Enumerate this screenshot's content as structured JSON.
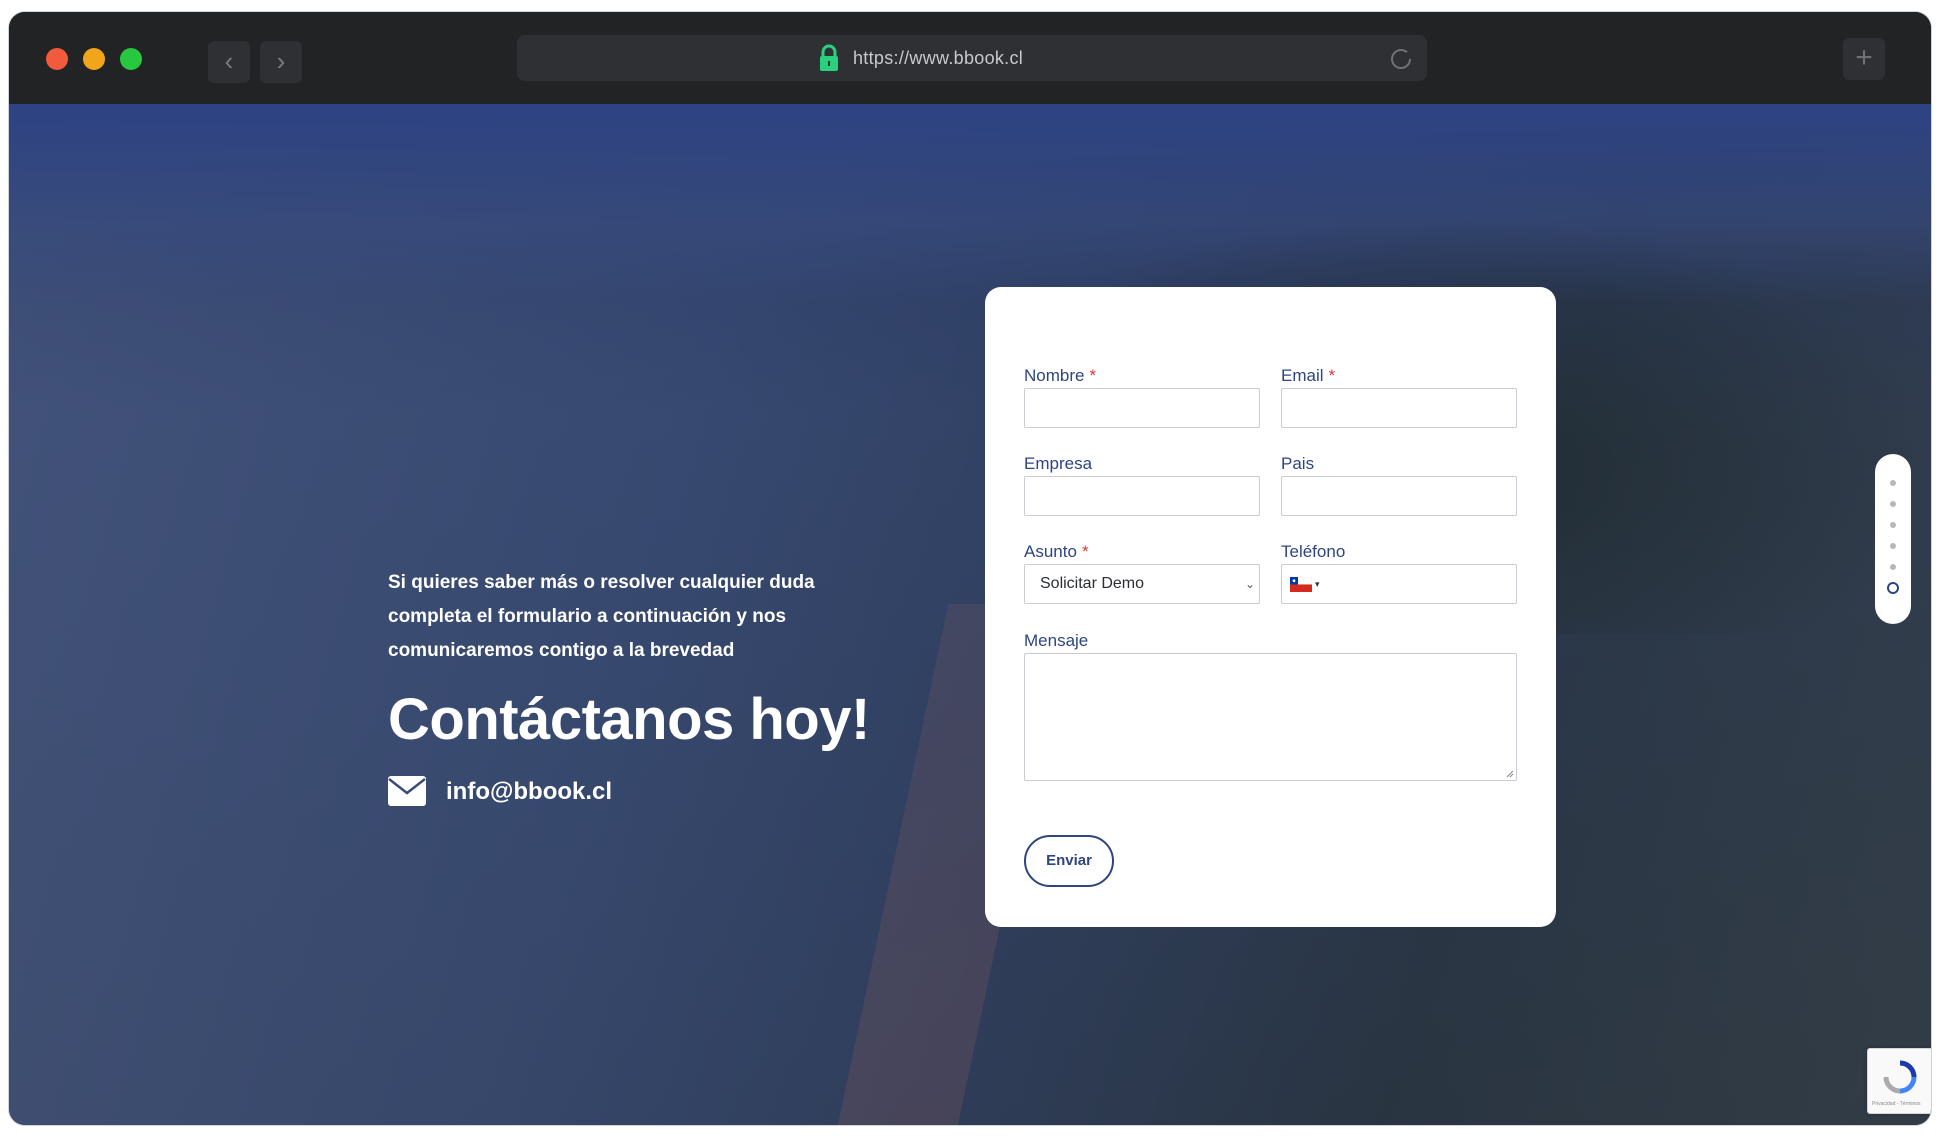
{
  "browser": {
    "url": "https://www.bbook.cl",
    "back_glyph": "‹",
    "forward_glyph": "›",
    "new_tab_glyph": "+",
    "traffic_lights": [
      "#f25a3d",
      "#f0a51b",
      "#27c840"
    ],
    "lock_color": "#2ad07f"
  },
  "hero": {
    "intro": "Si quieres saber más o resolver cualquier duda completa el formulario a continuación y nos comunicaremos contigo a la brevedad",
    "title": "Contáctanos hoy!",
    "email": "info@bbook.cl",
    "email_icon": "envelope-icon"
  },
  "form": {
    "nombre_label": "Nombre",
    "email_label": "Email",
    "empresa_label": "Empresa",
    "pais_label": "Pais",
    "asunto_label": "Asunto",
    "telefono_label": "Teléfono",
    "mensaje_label": "Mensaje",
    "required_marker": "*",
    "asunto_selected": "Solicitar Demo",
    "asunto_caret": "⌄",
    "phone_country_icon": "chile-flag-icon",
    "phone_caret": "▾",
    "submit_label": "Enviar"
  },
  "pager": {
    "count": 6,
    "active_index": 5
  },
  "recaptcha": {
    "footer": "Privacidad - Términos",
    "icon": "recaptcha-icon"
  },
  "colors": {
    "accent": "#2e4580",
    "required": "#d93636",
    "overlay": "#2d4383"
  }
}
